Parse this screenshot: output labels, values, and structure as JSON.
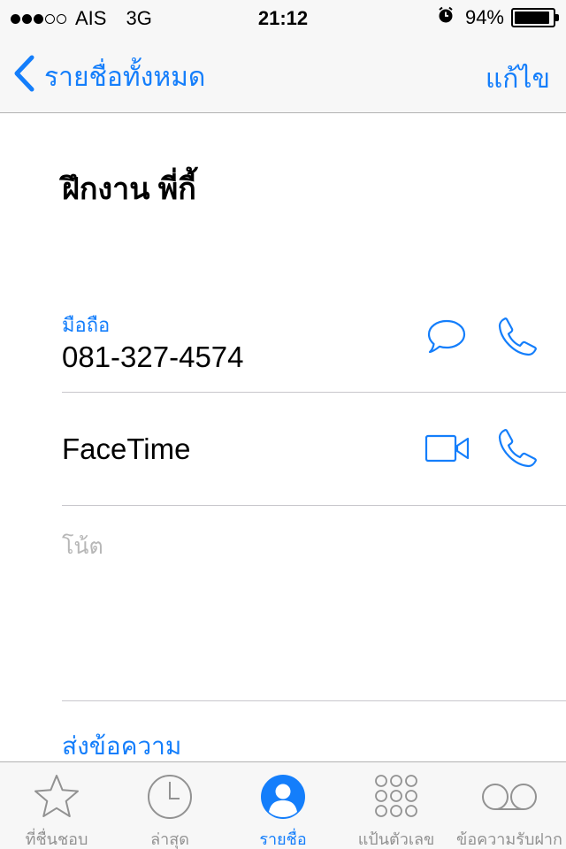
{
  "status_bar": {
    "carrier": "AIS",
    "network": "3G",
    "signal_bars_filled": 3,
    "signal_bars_total": 5,
    "time": "21:12",
    "battery_percent": "94%",
    "battery_level": 0.94,
    "alarm_icon": "alarm-clock-icon"
  },
  "nav": {
    "back_label": "รายชื่อทั้งหมด",
    "edit_label": "แก้ไข"
  },
  "contact": {
    "name": "ฝึกงาน พี่กี้",
    "phone_label": "มือถือ",
    "phone_number": "081-327-4574",
    "facetime_label": "FaceTime",
    "notes_label": "โน้ต",
    "send_message_label": "ส่งข้อความ"
  },
  "tabs": [
    {
      "label": "ที่ชื่นชอบ",
      "icon": "star-icon",
      "active": false
    },
    {
      "label": "ล่าสุด",
      "icon": "clock-icon",
      "active": false
    },
    {
      "label": "รายชื่อ",
      "icon": "contacts-icon",
      "active": true
    },
    {
      "label": "แป้นตัวเลข",
      "icon": "keypad-icon",
      "active": false
    },
    {
      "label": "ข้อความรับฝาก",
      "icon": "voicemail-icon",
      "active": false
    }
  ],
  "colors": {
    "accent": "#147efb",
    "inactive": "#929292",
    "placeholder": "#b7b7b7",
    "bar_background": "#f7f7f7"
  }
}
